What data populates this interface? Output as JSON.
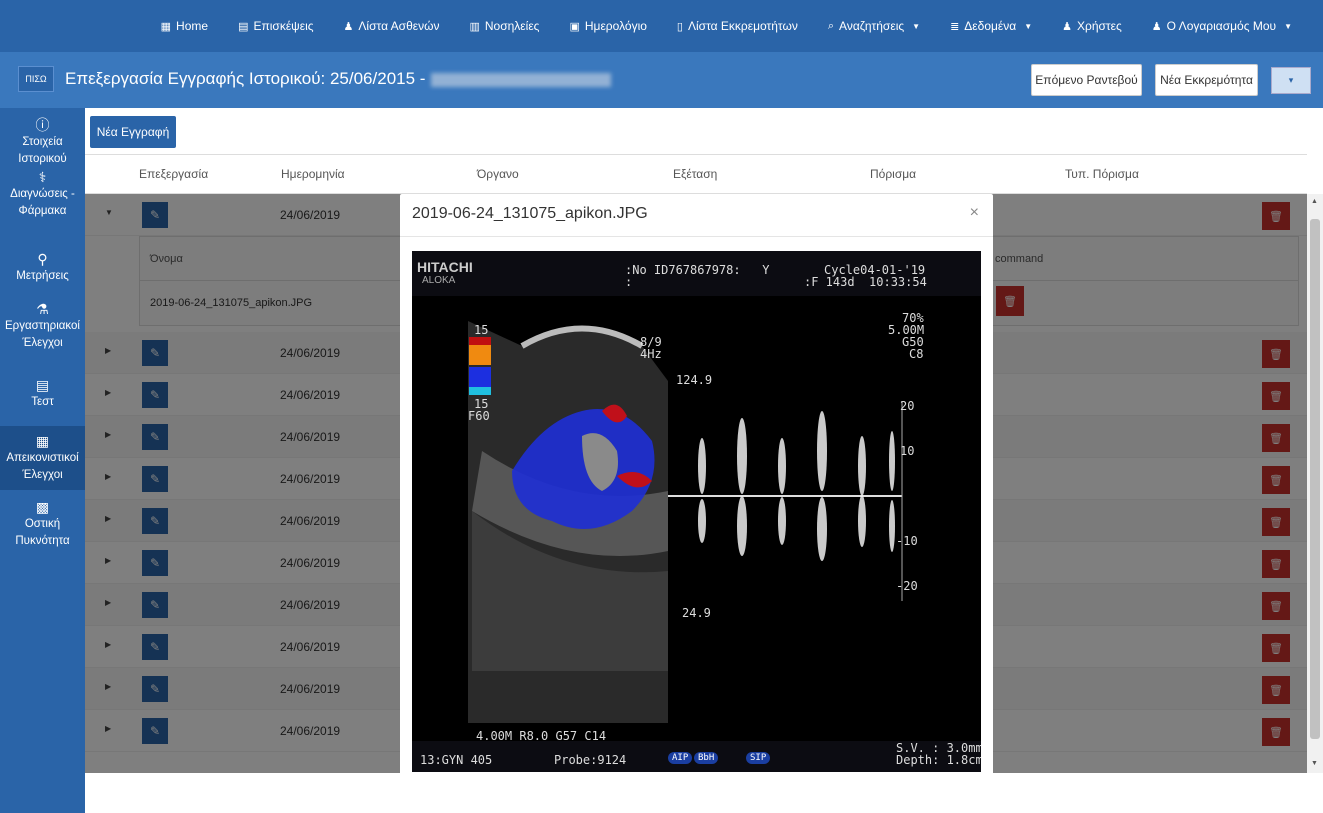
{
  "nav": [
    {
      "icon": "▦",
      "label": "Home",
      "caret": false,
      "icon_name": "building-icon"
    },
    {
      "icon": "▤",
      "label": "Επισκέψεις",
      "caret": false,
      "icon_name": "document-icon"
    },
    {
      "icon": "♟",
      "label": "Λίστα Ασθενών",
      "caret": false,
      "icon_name": "user-icon"
    },
    {
      "icon": "▥",
      "label": "Νοσηλείες",
      "caret": false,
      "icon_name": "hospital-icon"
    },
    {
      "icon": "▣",
      "label": "Ημερολόγιο",
      "caret": false,
      "icon_name": "calendar-icon"
    },
    {
      "icon": "▯",
      "label": "Λίστα Εκκρεμοτήτων",
      "caret": false,
      "icon_name": "clipboard-icon"
    },
    {
      "icon": "⌕",
      "label": "Αναζητήσεις",
      "caret": true,
      "icon_name": "search-icon"
    },
    {
      "icon": "≣",
      "label": "Δεδομένα",
      "caret": true,
      "icon_name": "database-icon"
    },
    {
      "icon": "♟",
      "label": "Χρήστες",
      "caret": false,
      "icon_name": "users-icon"
    },
    {
      "icon": "♟",
      "label": "Ο Λογαριασμός Μου",
      "caret": true,
      "icon_name": "account-icon"
    }
  ],
  "header": {
    "logo": "ΠΙΣΩ",
    "title": "Επεξεργασία Εγγραφής Ιστορικού: 25/06/2015 -",
    "next_appointment": "Επόμενο Ραντεβού",
    "new_pending": "Νέα Εκκρεμότητα",
    "dropdown_caret": "▾"
  },
  "sidebar": [
    {
      "icon": "ⓘ",
      "label": "Στοιχεία Ιστορικού",
      "icon_name": "info-icon",
      "active": false
    },
    {
      "icon": "⚕",
      "label": "Διαγνώσεις - Φάρμακα",
      "icon_name": "pills-icon",
      "active": false
    },
    {
      "icon": "⚲",
      "label": "Μετρήσεις",
      "icon_name": "stethoscope-icon",
      "active": false
    },
    {
      "icon": "⚗",
      "label": "Εργαστηριακοί Έλεγχοι",
      "icon_name": "flask-icon",
      "active": false
    },
    {
      "icon": "▤",
      "label": "Τεστ",
      "icon_name": "clipboard-list-icon",
      "active": false
    },
    {
      "icon": "▦",
      "label": "Απεικονιστικοί Έλεγχοι",
      "icon_name": "clipboard-image-icon",
      "active": true
    },
    {
      "icon": "▩",
      "label": "Οστική Πυκνότητα",
      "icon_name": "bone-density-icon",
      "active": false
    }
  ],
  "table": {
    "new_record": "Νέα Εγγραφή",
    "columns": [
      "Επεξεργασία",
      "Ημερομηνία",
      "Όργανο",
      "Εξέταση",
      "Πόρισμα",
      "Τυπ. Πόρισμα"
    ],
    "dates": [
      "24/06/2019",
      "24/06/2019",
      "24/06/2019",
      "24/06/2019",
      "24/06/2019",
      "24/06/2019",
      "24/06/2019",
      "24/06/2019",
      "24/06/2019",
      "24/06/2019",
      "24/06/2019"
    ],
    "sub": {
      "name_col": "Όνομα",
      "command_col": "command",
      "file": "2019-06-24_131075_apikon.JPG"
    }
  },
  "modal": {
    "title": "2019-06-24_131075_apikon.JPG",
    "close": "×"
  },
  "us": {
    "brand1": "HITACHI",
    "brand2": "ALOKA",
    "id": ":No ID767867978:   Y",
    "id2": ":",
    "cycle": "Cycle04-01-'19",
    "f": ":F 143d  10:33:54",
    "p1": "70%",
    "p2": "5.00M",
    "p3": "G50",
    "p4": "C8",
    "s15a": "15",
    "s15b": "15",
    "f60": "F60",
    "frac": "8/9",
    "hz": "4Hz",
    "v124a": "124.9",
    "v124b": "24.9",
    "v20a": "20",
    "v10a": "10",
    "v10b": "-10",
    "v20b": "-20",
    "bottom": "4.00M R8.0 G57 C14",
    "gyn": "13:GYN 405",
    "probe": "Probe:9124",
    "aip": "AIP",
    "bbh": "BbH",
    "sip": "SIP",
    "sv": "S.V. : 3.0mm",
    "depth": "Depth: 1.8cm"
  }
}
